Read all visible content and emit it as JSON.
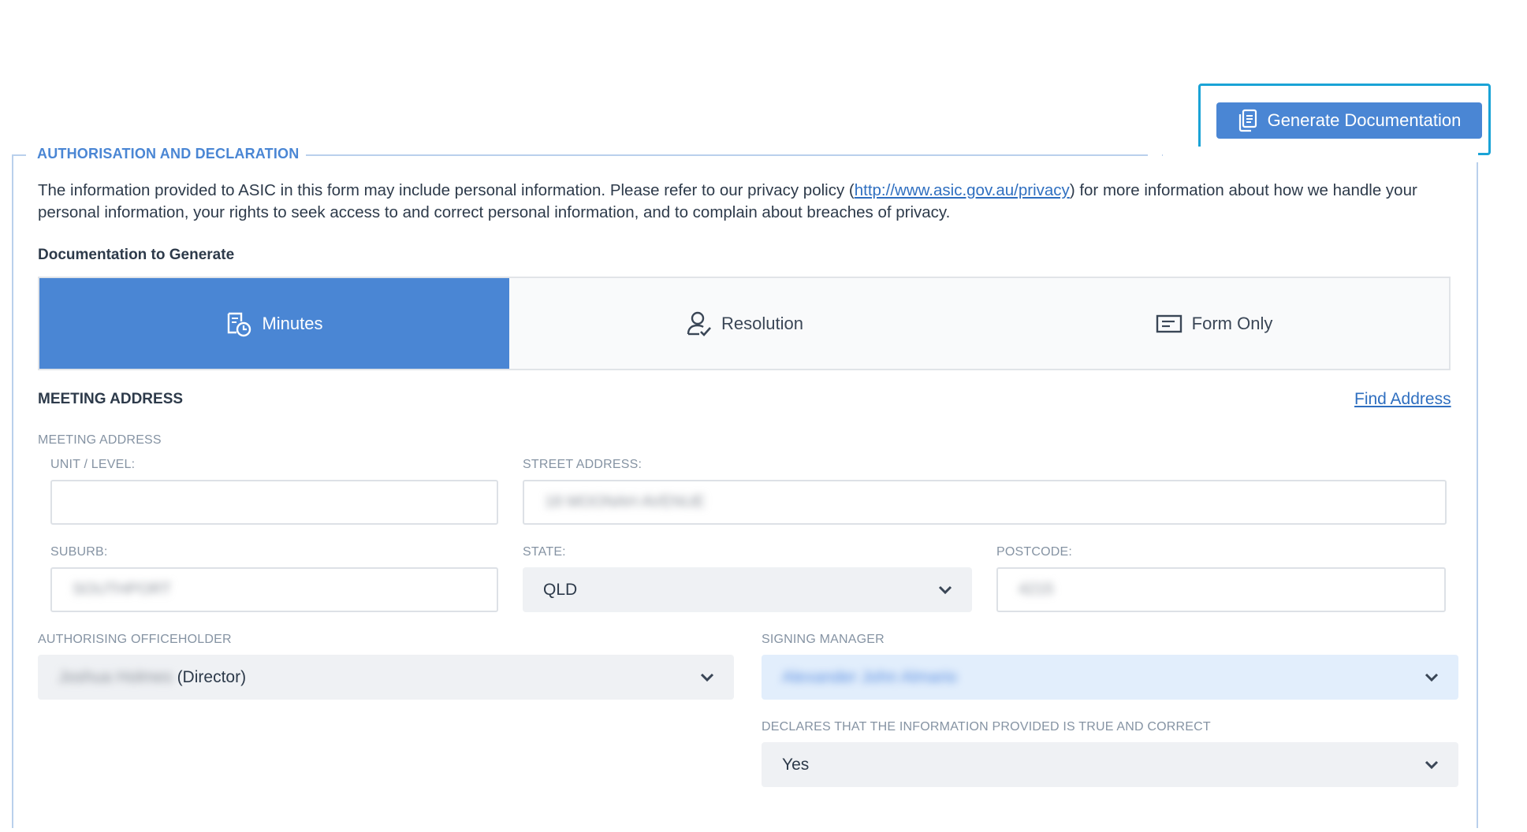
{
  "toolbar": {
    "generate_label": "Generate Documentation"
  },
  "section": {
    "legend": "AUTHORISATION AND DECLARATION",
    "privacy_before": "The information provided to ASIC in this form may include personal information. Please refer to our privacy policy (",
    "privacy_link": "http://www.asic.gov.au/privacy",
    "privacy_after": ") for more information about how we handle your personal information, your rights to seek access to and correct personal information, and to complain about breaches of privacy."
  },
  "documentation": {
    "label": "Documentation to Generate",
    "options": [
      {
        "label": "Minutes",
        "icon": "minutes-icon",
        "active": true
      },
      {
        "label": "Resolution",
        "icon": "resolution-icon",
        "active": false
      },
      {
        "label": "Form Only",
        "icon": "form-icon",
        "active": false
      }
    ]
  },
  "meeting": {
    "title": "MEETING ADDRESS",
    "find_address": "Find Address",
    "group_label": "MEETING ADDRESS",
    "unit_label": "UNIT / LEVEL:",
    "unit_value": "",
    "street_label": "STREET ADDRESS:",
    "street_value": "18 MOONAH AVENUE",
    "suburb_label": "SUBURB:",
    "suburb_value": "SOUTHPORT",
    "state_label": "STATE:",
    "state_value": "QLD",
    "postcode_label": "POSTCODE:",
    "postcode_value": "4215"
  },
  "authorising": {
    "officeholder_label": "AUTHORISING OFFICEHOLDER",
    "officeholder_name": "Joshua Holmes",
    "officeholder_role": " (Director)",
    "manager_label": "SIGNING MANAGER",
    "manager_value": "Alexander John Almario",
    "declare_label": "DECLARES THAT THE INFORMATION PROVIDED IS TRUE AND CORRECT",
    "declare_value": "Yes"
  },
  "colors": {
    "accent": "#4a86d4",
    "highlight": "#1aa3d6",
    "link": "#2f6fc0"
  }
}
